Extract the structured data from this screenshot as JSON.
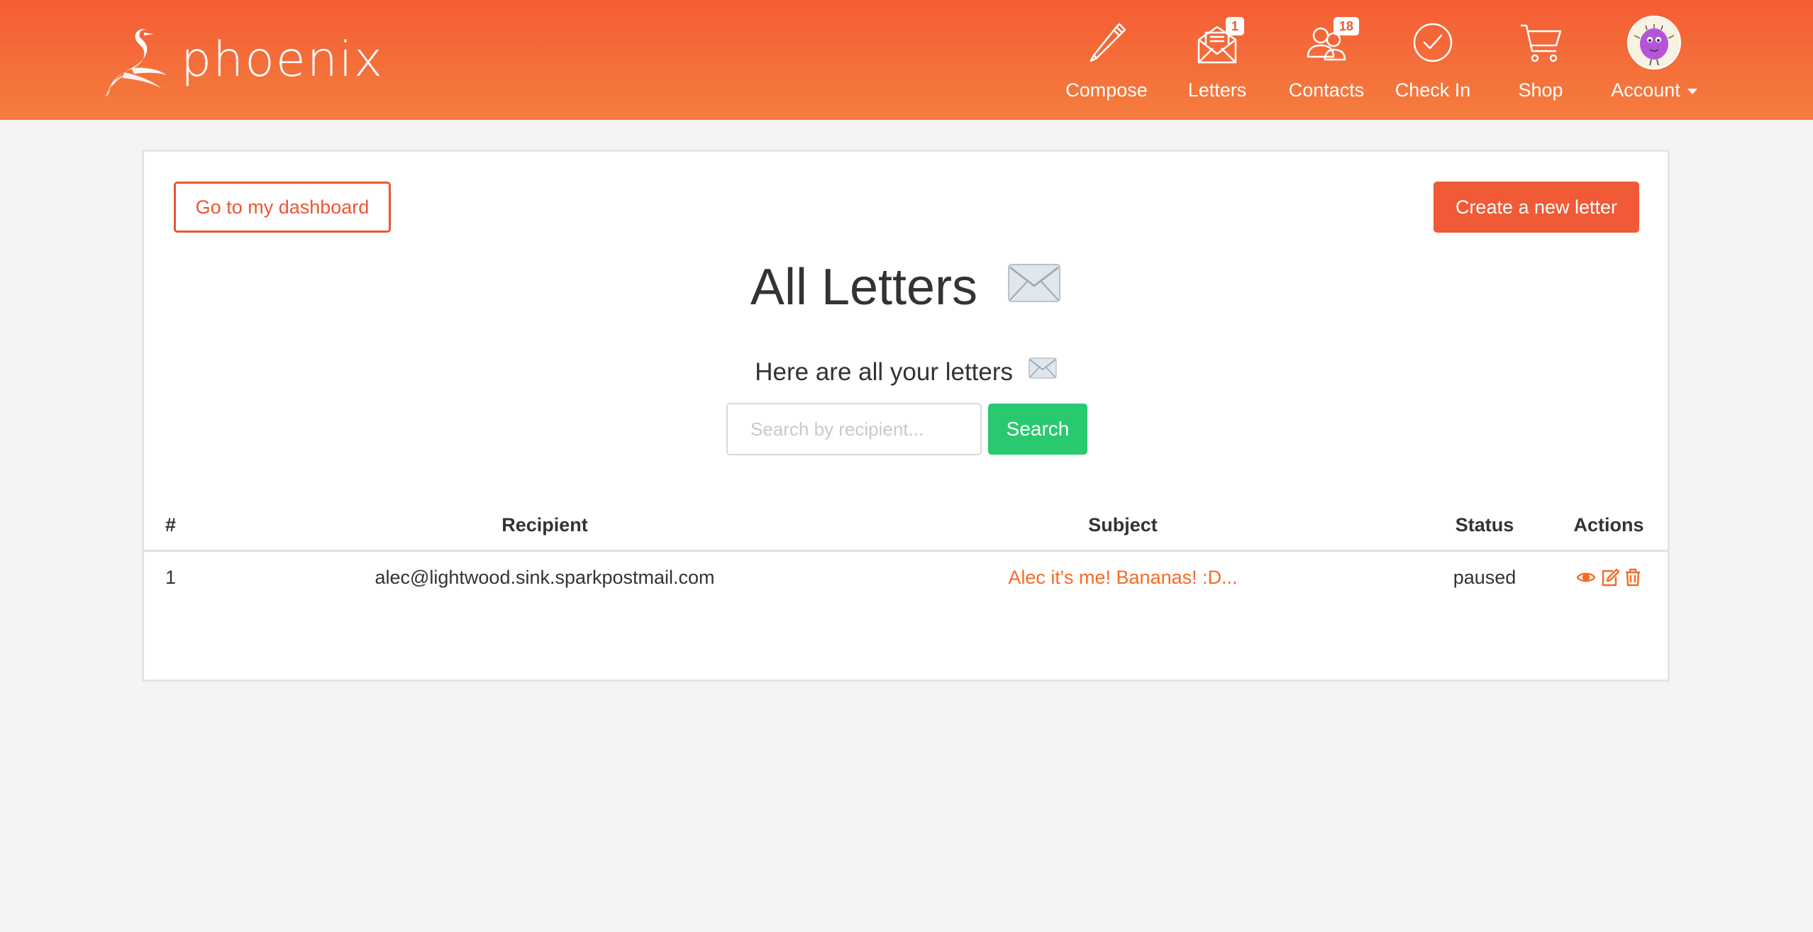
{
  "brand": {
    "name": "phoenix"
  },
  "nav": [
    {
      "label": "Compose",
      "icon": "pencil-icon"
    },
    {
      "label": "Letters",
      "icon": "letters-icon",
      "badge": "1"
    },
    {
      "label": "Contacts",
      "icon": "contacts-icon",
      "badge": "18"
    },
    {
      "label": "Check In",
      "icon": "check-circle-icon"
    },
    {
      "label": "Shop",
      "icon": "cart-icon"
    },
    {
      "label": "Account",
      "icon": "avatar"
    }
  ],
  "toolbar": {
    "dashboard_label": "Go to my dashboard",
    "create_label": "Create a new letter"
  },
  "page": {
    "title": "All Letters",
    "subtitle": "Here are all your letters"
  },
  "search": {
    "placeholder": "Search by recipient...",
    "value": "",
    "button_label": "Search"
  },
  "table": {
    "headers": {
      "num": "#",
      "recipient": "Recipient",
      "subject": "Subject",
      "status": "Status",
      "actions": "Actions"
    },
    "rows": [
      {
        "num": "1",
        "recipient": "alec@lightwood.sink.sparkpostmail.com",
        "subject": "Alec it's me! Bananas! :D...",
        "status": "paused"
      }
    ]
  },
  "colors": {
    "header_top": "#f45d35",
    "header_bottom": "#f57d3e",
    "accent": "#f05a36",
    "link": "#f46a26",
    "search_button": "#29c96f",
    "background": "#f4f4f4"
  }
}
